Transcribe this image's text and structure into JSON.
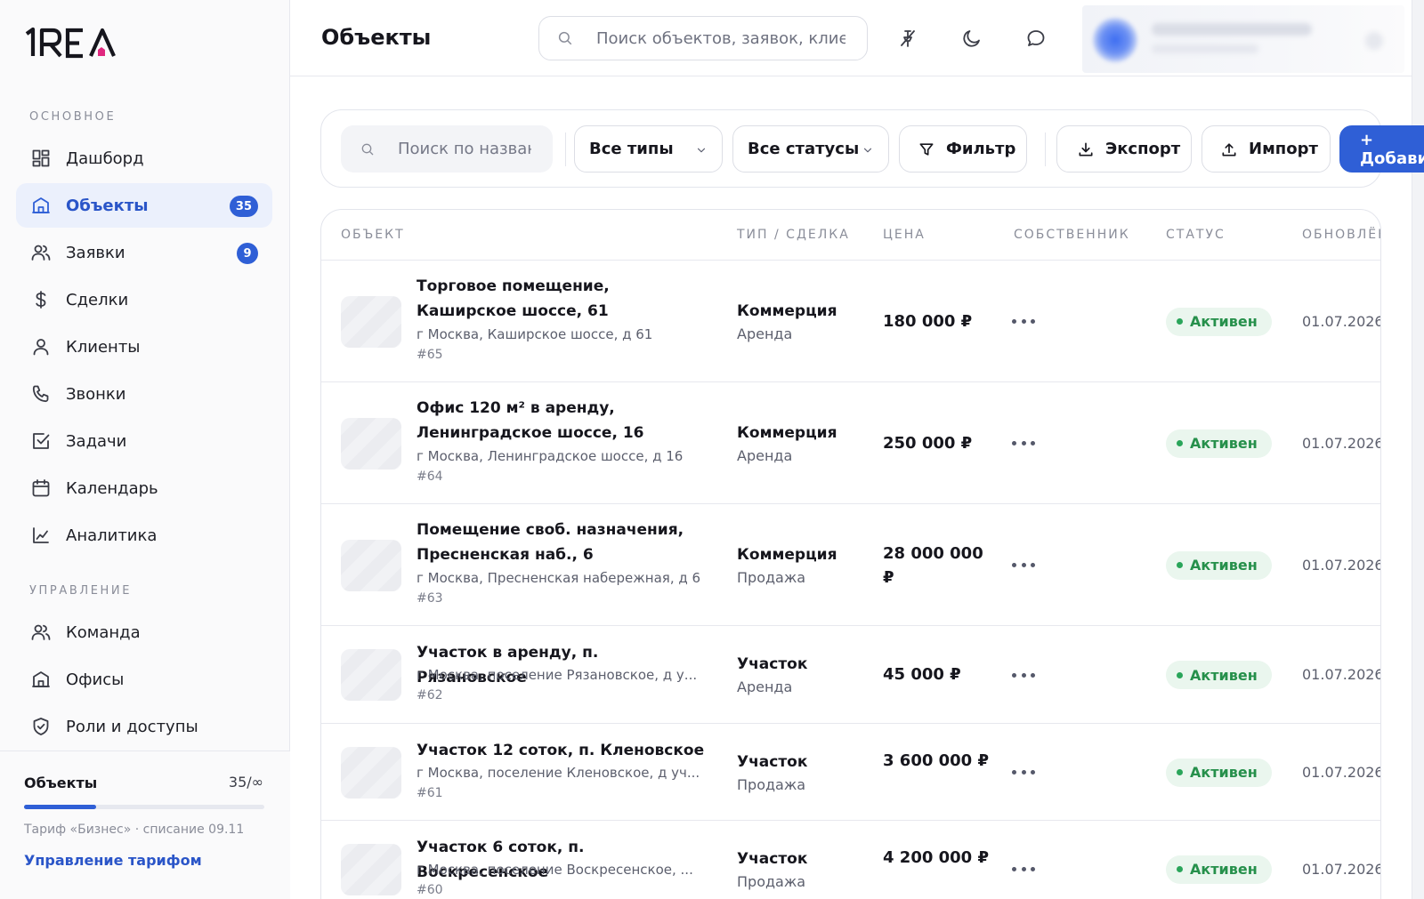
{
  "brand": {
    "logo_text": "1REA",
    "accent": "#2f5fd6",
    "house_accent": "#e0287f"
  },
  "sidebar": {
    "section_main": "ОСНОВНОЕ",
    "section_manage": "УПРАВЛЕНИЕ",
    "main_items": [
      {
        "label": "Дашборд",
        "icon": "dashboard-icon"
      },
      {
        "label": "Объекты",
        "icon": "building-icon",
        "badge": "35",
        "active": true
      },
      {
        "label": "Заявки",
        "icon": "users-icon",
        "badge": "9"
      },
      {
        "label": "Сделки",
        "icon": "dollar-icon"
      },
      {
        "label": "Клиенты",
        "icon": "user-icon"
      },
      {
        "label": "Звонки",
        "icon": "phone-icon"
      },
      {
        "label": "Задачи",
        "icon": "checkbox-icon"
      },
      {
        "label": "Календарь",
        "icon": "calendar-icon"
      },
      {
        "label": "Аналитика",
        "icon": "chart-line-icon"
      }
    ],
    "manage_items": [
      {
        "label": "Команда",
        "icon": "team-icon"
      },
      {
        "label": "Офисы",
        "icon": "office-icon"
      },
      {
        "label": "Роли и доступы",
        "icon": "shield-check-icon"
      }
    ],
    "footer": {
      "title": "Объекты",
      "count": "35/∞",
      "usage_fraction": 0.3,
      "plan": "Тариф «Бизнес» · списание 09.11",
      "manage_link": "Управление тарифом"
    }
  },
  "header": {
    "title": "Объекты",
    "search_placeholder": "Поиск объектов, заявок, клиентов",
    "icons": [
      "pin-off-icon",
      "moon-icon",
      "chat-icon"
    ]
  },
  "toolbar": {
    "search_placeholder": "Поиск по названию",
    "type_select": "Все типы",
    "status_select": "Все статусы",
    "filter_label": "Фильтр",
    "export_label": "Экспорт",
    "import_label": "Импорт",
    "add_label": "+ Добавить"
  },
  "table": {
    "columns": [
      "ОБЪЕКТ",
      "ТИП / СДЕЛКА",
      "ЦЕНА",
      "СОБСТВЕННИК",
      "СТАТУС",
      "ОБНОВЛЁН"
    ],
    "rows": [
      {
        "title": "Торговое помещение, Каширское шоссе, 61",
        "address": "г Москва, Каширское шоссе, д 61",
        "id": "#65",
        "type": "Коммерция",
        "deal": "Аренда",
        "price": "180 000 ₽",
        "status": "Активен",
        "updated": "01.07.2026"
      },
      {
        "title": "Офис 120 м² в аренду, Ленинградское шоссе, 16",
        "address": "г Москва, Ленинградское шоссе, д 16",
        "id": "#64",
        "type": "Коммерция",
        "deal": "Аренда",
        "price": "250 000 ₽",
        "status": "Активен",
        "updated": "01.07.2026"
      },
      {
        "title": "Помещение своб. назначения, Пресненская наб., 6",
        "address": "г Москва, Пресненская набережная, д 6",
        "id": "#63",
        "type": "Коммерция",
        "deal": "Продажа",
        "price": "28 000 000 ₽",
        "status": "Активен",
        "updated": "01.07.2026"
      },
      {
        "title": "Участок в аренду, п. Рязановское",
        "address": "г Москва, поселение Рязановское, д у...",
        "id": "#62",
        "type": "Участок",
        "deal": "Аренда",
        "price": "45 000 ₽",
        "status": "Активен",
        "updated": "01.07.2026"
      },
      {
        "title": "Участок 12 соток, п. Кленовское",
        "address": "г Москва, поселение Кленовское, д уч...",
        "id": "#61",
        "type": "Участок",
        "deal": "Продажа",
        "price": "3 600 000 ₽",
        "status": "Активен",
        "updated": "01.07.2026"
      },
      {
        "title": "Участок 6 соток, п. Воскресенское",
        "address": "г Москва, поселение Воскресенское, ...",
        "id": "#60",
        "type": "Участок",
        "deal": "Продажа",
        "price": "4 200 000 ₽",
        "status": "Активен",
        "updated": "01.07.2026"
      }
    ]
  }
}
